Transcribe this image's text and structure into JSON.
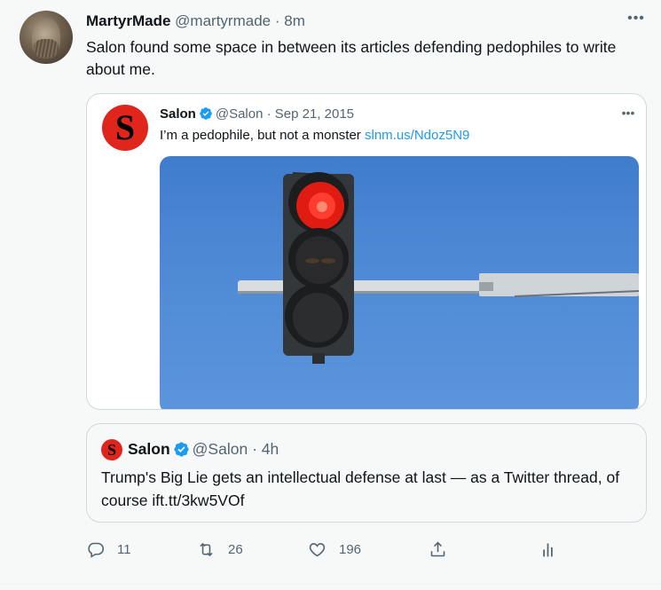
{
  "tweet": {
    "author_name": "MartyrMade",
    "author_handle": "@martyrmade",
    "separator": "·",
    "time": "8m",
    "text": "Salon found some space in between its articles defending pedophiles to write about me.",
    "more_icon": "more-horizontal-icon"
  },
  "quote1": {
    "logo_letter": "S",
    "name": "Salon",
    "handle": "@Salon",
    "separator": "·",
    "date": "Sep 21, 2015",
    "text": "I’m a pedophile, but not a monster ",
    "link": "slnm.us/Ndoz5N9",
    "verified_icon": "verified-badge-icon",
    "image_desc_icon": "traffic-light-photo"
  },
  "quote2": {
    "logo_letter": "S",
    "name": "Salon",
    "handle": "@Salon",
    "separator": "·",
    "time": "4h",
    "text": "Trump's Big Lie gets an intellectual defense at last — as a Twitter thread, of course ift.tt/3kw5VOf"
  },
  "actions": {
    "reply_count": "11",
    "retweet_count": "26",
    "like_count": "196"
  },
  "colors": {
    "link": "#1d9bf0",
    "secondary_text": "#536471",
    "salon_red": "#e0261c",
    "verified_blue": "#1d9bf0"
  }
}
